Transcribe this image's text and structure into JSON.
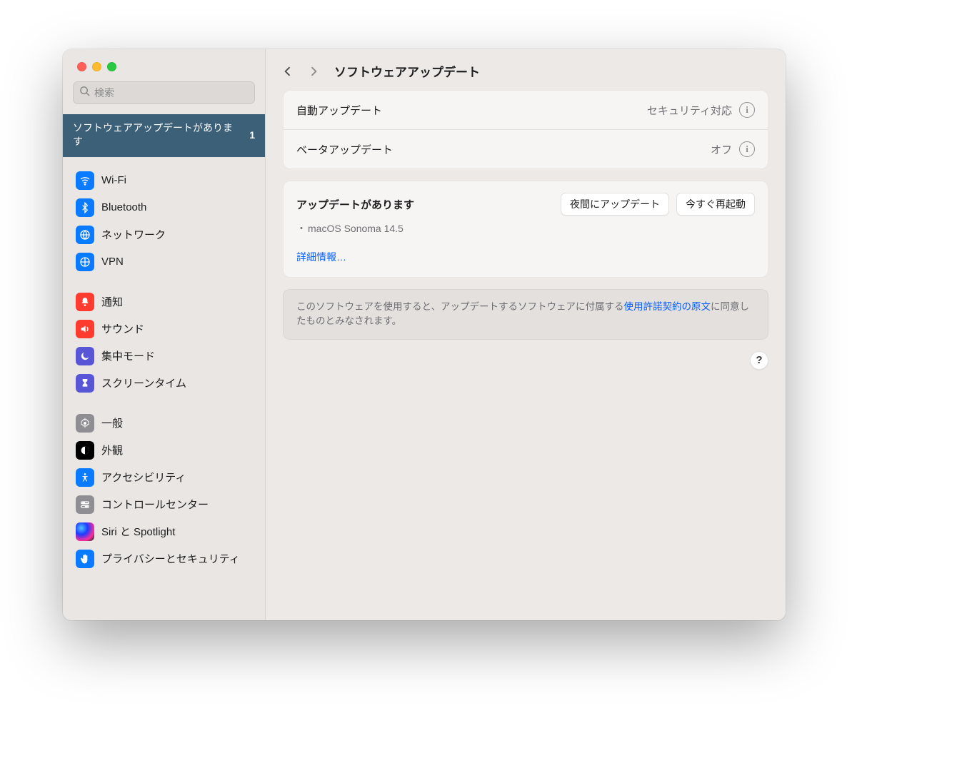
{
  "search": {
    "placeholder": "検索"
  },
  "banner": {
    "text": "ソフトウェアアップデートがあります",
    "badge": "1"
  },
  "sidebar": {
    "groups": [
      [
        {
          "label": "Wi-Fi"
        },
        {
          "label": "Bluetooth"
        },
        {
          "label": "ネットワーク"
        },
        {
          "label": "VPN"
        }
      ],
      [
        {
          "label": "通知"
        },
        {
          "label": "サウンド"
        },
        {
          "label": "集中モード"
        },
        {
          "label": "スクリーンタイム"
        }
      ],
      [
        {
          "label": "一般"
        },
        {
          "label": "外観"
        },
        {
          "label": "アクセシビリティ"
        },
        {
          "label": "コントロールセンター"
        },
        {
          "label": "Siri と Spotlight"
        },
        {
          "label": "プライバシーとセキュリティ"
        }
      ]
    ]
  },
  "page": {
    "title": "ソフトウェアアップデート"
  },
  "rows": {
    "auto": {
      "label": "自動アップデート",
      "value": "セキュリティ対応"
    },
    "beta": {
      "label": "ベータアップデート",
      "value": "オフ"
    }
  },
  "updates": {
    "heading": "アップデートがあります",
    "btn_tonight": "夜間にアップデート",
    "btn_restart": "今すぐ再起動",
    "item": "macOS Sonoma 14.5",
    "more": "詳細情報…"
  },
  "legal": {
    "prefix": "このソフトウェアを使用すると、アップデートするソフトウェアに付属する",
    "link": "使用許諾契約の原文",
    "suffix": "に同意したものとみなされます。"
  },
  "help": "?"
}
